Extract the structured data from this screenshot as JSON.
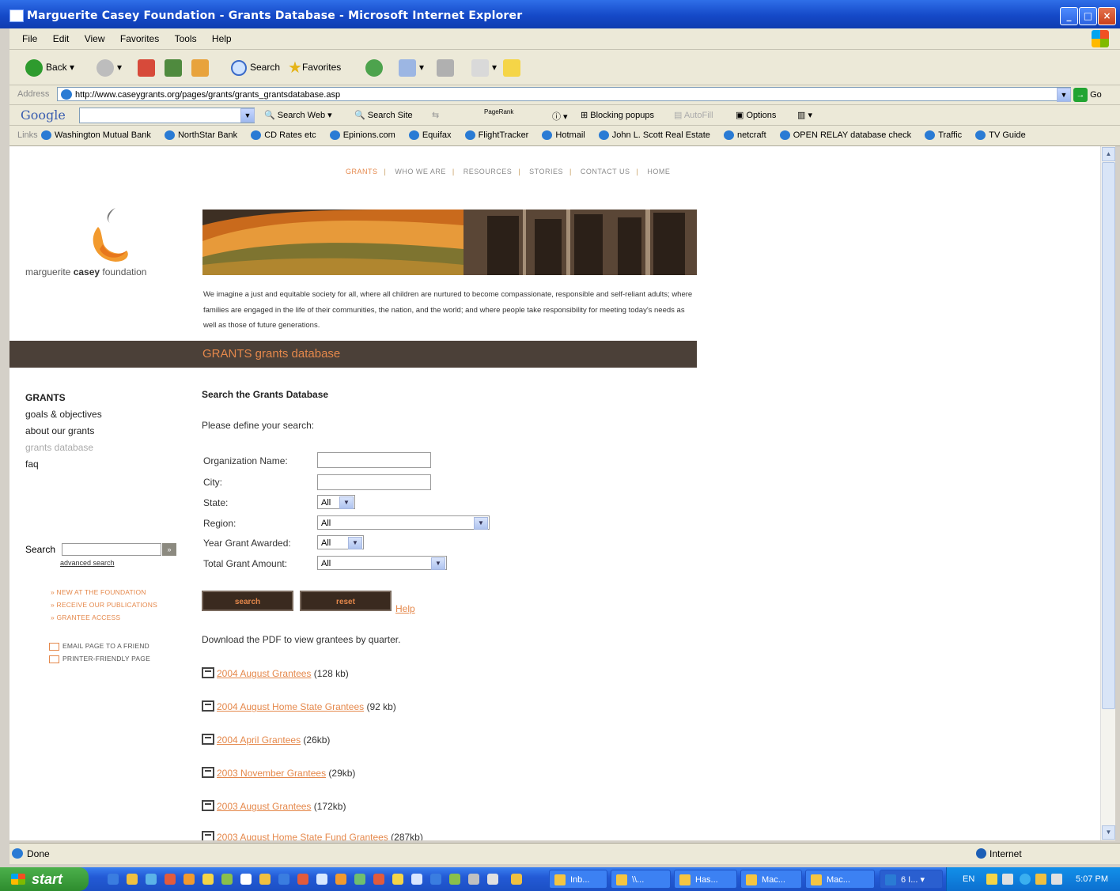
{
  "window": {
    "title": "Marguerite Casey Foundation - Grants Database - Microsoft Internet Explorer",
    "controls": [
      "_",
      "□",
      "×"
    ]
  },
  "menu": [
    "File",
    "Edit",
    "View",
    "Favorites",
    "Tools",
    "Help"
  ],
  "toolbar": {
    "back": "Back",
    "search": "Search",
    "favorites": "Favorites"
  },
  "address": {
    "label": "Address",
    "url": "http://www.caseygrants.org/pages/grants/grants_grantsdatabase.asp",
    "go": "Go"
  },
  "google_bar": {
    "logo": "Google",
    "search_web": "Search Web",
    "search_site": "Search Site",
    "pagerank": "PageRank",
    "blocking": "Blocking popups",
    "autofill": "AutoFill",
    "options": "Options"
  },
  "links_bar": {
    "label": "Links",
    "items": [
      "Washington Mutual Bank",
      "NorthStar Bank",
      "CD Rates etc",
      "Epinions.com",
      "Equifax",
      "FlightTracker",
      "Hotmail",
      "John L. Scott Real Estate",
      "netcraft",
      "OPEN RELAY database check",
      "Traffic",
      "TV Guide"
    ]
  },
  "site_nav": [
    "GRANTS",
    "WHO WE ARE",
    "RESOURCES",
    "STORIES",
    "CONTACT US",
    "HOME"
  ],
  "logo": {
    "pre": "marguerite ",
    "bold": "casey",
    "post": " foundation"
  },
  "mission": "We imagine a just and equitable society for all, where all children are nurtured to become compassionate, responsible and self-reliant adults; where families are engaged in the life of their communities, the nation, and the world; and where people take responsibility for meeting today's needs as well as those of future generations.",
  "band": {
    "section": "GRANTS",
    "title": " grants database"
  },
  "left_nav": {
    "heading": "GRANTS",
    "items": [
      "goals & objectives",
      "about our grants",
      "grants database",
      "faq"
    ],
    "search_label": "Search",
    "search_go": "»",
    "advanced": "advanced search",
    "promo": [
      "» NEW AT THE FOUNDATION",
      "» RECEIVE OUR PUBLICATIONS",
      "» GRANTEE ACCESS"
    ],
    "util": [
      "EMAIL PAGE TO A FRIEND",
      "PRINTER-FRIENDLY PAGE"
    ]
  },
  "form": {
    "title": "Search the Grants Database",
    "intro": "Please define your search:",
    "labels": {
      "org": "Organization Name:",
      "city": "City:",
      "state": "State:",
      "region": "Region:",
      "year": "Year Grant Awarded:",
      "amount": "Total Grant Amount:"
    },
    "values": {
      "org": "",
      "city": "",
      "state": "All",
      "region": "All",
      "year": "All",
      "amount": "All"
    },
    "search_btn": "search",
    "reset_btn": "reset",
    "help": "Help"
  },
  "downloads": {
    "intro": "Download the PDF to view grantees by quarter.",
    "items": [
      {
        "label": "2004 August Grantees",
        "size": " (128 kb)"
      },
      {
        "label": "2004 August Home State Grantees",
        "size": " (92 kb)"
      },
      {
        "label": "2004 April Grantees",
        "size": " (26kb)"
      },
      {
        "label": "2003 November Grantees",
        "size": " (29kb)"
      },
      {
        "label": "2003 August Grantees",
        "size": " (172kb)"
      },
      {
        "label": "2003 August Home State Fund Grantees",
        "size": " (287kb)"
      }
    ]
  },
  "status": {
    "text": "Done",
    "zone": "Internet"
  },
  "taskbar": {
    "start": "start",
    "tasks": [
      "Inb...",
      "\\\\...",
      "Has...",
      "Mac...",
      "Mac...",
      "6 I..."
    ],
    "lang": "EN",
    "clock": "5:07 PM"
  }
}
